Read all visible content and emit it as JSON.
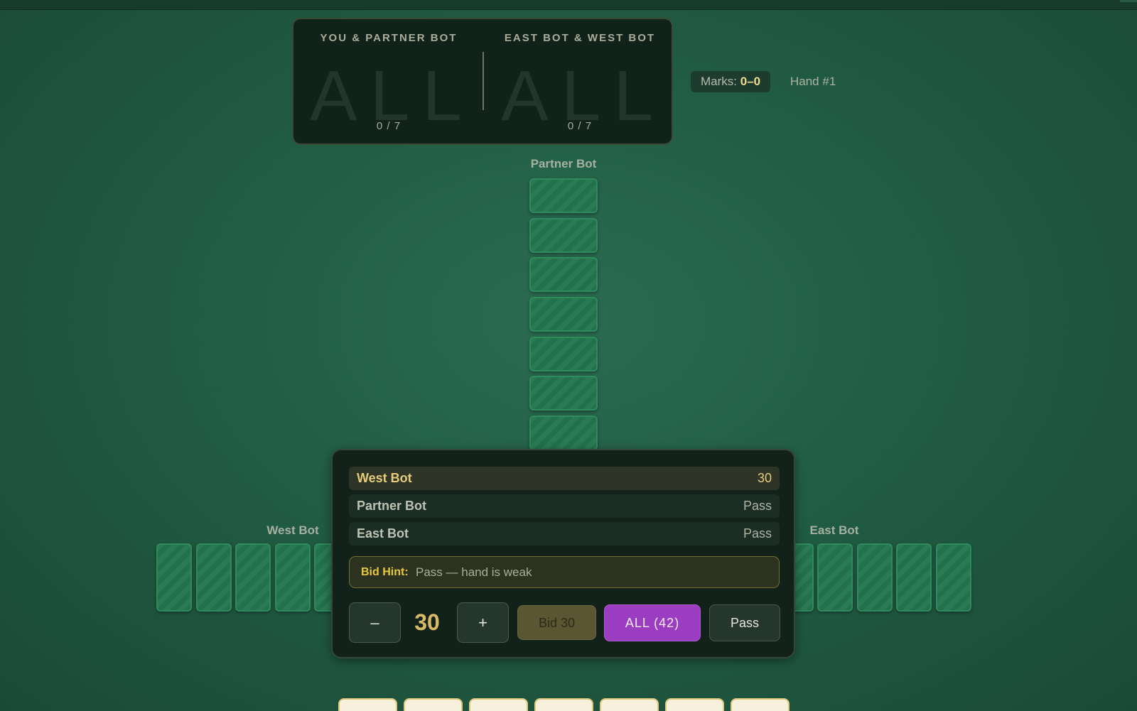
{
  "scoreboard": {
    "team1": {
      "label": "YOU & PARTNER BOT",
      "big": "ALL",
      "count": "0 / 7"
    },
    "team2": {
      "label": "EAST BOT & WEST BOT",
      "big": "ALL",
      "count": "0 / 7"
    }
  },
  "marks": {
    "label": "Marks:",
    "value": "0–0"
  },
  "hand": {
    "label": "Hand #1"
  },
  "players": {
    "north": "Partner Bot",
    "west": "West Bot",
    "east": "East Bot"
  },
  "bids": [
    {
      "player": "West Bot",
      "bid": "30",
      "active": true
    },
    {
      "player": "Partner Bot",
      "bid": "Pass",
      "active": false
    },
    {
      "player": "East Bot",
      "bid": "Pass",
      "active": false
    }
  ],
  "hint": {
    "label": "Bid Hint:",
    "text": "Pass — hand is weak"
  },
  "controls": {
    "decrement": "–",
    "amount": "30",
    "increment": "+",
    "bid_label": "Bid 30",
    "all_label": "ALL (42)",
    "pass_label": "Pass"
  },
  "colors": {
    "felt": "#215c44",
    "accent_all": "#9b3dc1",
    "hint_gold": "#e8c93c",
    "active_bid": "#e6cb7a"
  }
}
